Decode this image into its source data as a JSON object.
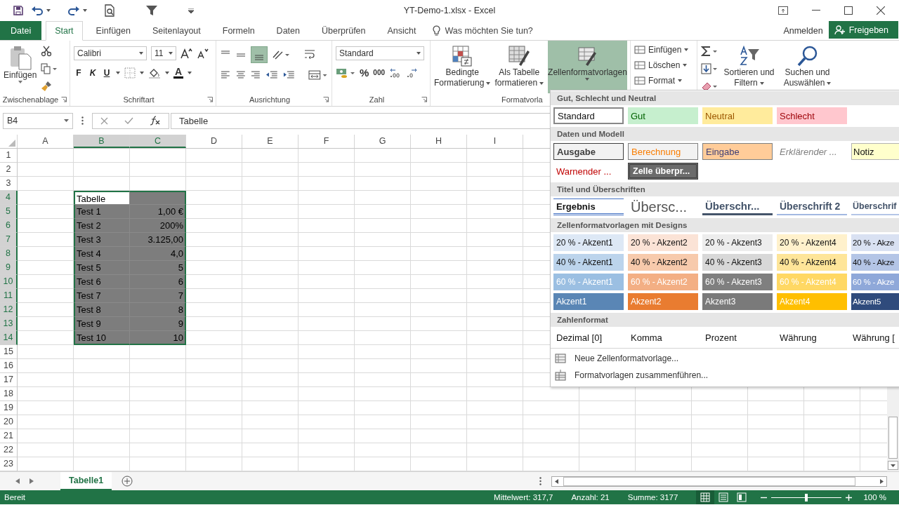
{
  "title_bar": {
    "title": "YT-Demo-1.xlsx - Excel"
  },
  "tabs": [
    {
      "label": "Datei",
      "kind": "file",
      "selected": false
    },
    {
      "label": "Start",
      "kind": "tab",
      "selected": true
    },
    {
      "label": "Einfügen",
      "kind": "tab",
      "selected": false
    },
    {
      "label": "Seitenlayout",
      "kind": "tab",
      "selected": false
    },
    {
      "label": "Formeln",
      "kind": "tab",
      "selected": false
    },
    {
      "label": "Daten",
      "kind": "tab",
      "selected": false
    },
    {
      "label": "Überprüfen",
      "kind": "tab",
      "selected": false
    },
    {
      "label": "Ansicht",
      "kind": "tab",
      "selected": false
    }
  ],
  "tell_me": {
    "placeholder": "Was möchten Sie tun?"
  },
  "account": {
    "sign_in": "Anmelden",
    "share": "Freigeben"
  },
  "ribbon": {
    "clipboard": {
      "paste": "Einfügen",
      "label": "Zwischenablage"
    },
    "font": {
      "name": "Calibri",
      "size": "11",
      "bold": "F",
      "italic": "K",
      "underline": "U",
      "font_color": "A",
      "label": "Schriftart"
    },
    "alignment": {
      "label": "Ausrichtung",
      "bottom_align_on": true
    },
    "number": {
      "format": "Standard",
      "percent": "%",
      "thousands": "000",
      "label": "Zahl"
    },
    "styles": {
      "conditional": [
        "Bedingte",
        "Formatierung"
      ],
      "as_table": [
        "Als Tabelle",
        "formatieren"
      ],
      "cell_styles": {
        "label": "Zellenformatvorlagen",
        "pressed": true
      },
      "label": "Formatvorla"
    },
    "cells": [
      {
        "label": "Einfügen"
      },
      {
        "label": "Löschen"
      },
      {
        "label": "Format"
      }
    ],
    "editing": {
      "sort": [
        "Sortieren und",
        "Filtern"
      ],
      "find": [
        "Suchen und",
        "Auswählen"
      ]
    }
  },
  "formula_bar": {
    "name_box": "B4",
    "content": "Tabelle"
  },
  "sheet": {
    "columns": [
      {
        "label": "A",
        "selected": false
      },
      {
        "label": "B",
        "selected": true
      },
      {
        "label": "C",
        "selected": true
      },
      {
        "label": "D",
        "selected": false
      },
      {
        "label": "E",
        "selected": false
      },
      {
        "label": "F",
        "selected": false
      },
      {
        "label": "G",
        "selected": false
      },
      {
        "label": "H",
        "selected": false
      },
      {
        "label": "I",
        "selected": false
      }
    ],
    "rows": [
      {
        "label": "1",
        "selected": false
      },
      {
        "label": "2",
        "selected": false
      },
      {
        "label": "3",
        "selected": false
      },
      {
        "label": "4",
        "selected": true,
        "cells": [
          {
            "text": "Tabelle",
            "active": true
          }
        ]
      },
      {
        "label": "5",
        "selected": true,
        "cells": [
          {
            "text": "Test 1",
            "active": false
          },
          {
            "text": "1,00 €",
            "active": false
          }
        ]
      },
      {
        "label": "6",
        "selected": true,
        "cells": [
          {
            "text": "Test 2",
            "active": false
          },
          {
            "text": "200%",
            "active": false
          }
        ]
      },
      {
        "label": "7",
        "selected": true,
        "cells": [
          {
            "text": "Test 3",
            "active": false
          },
          {
            "text": "3.125,00",
            "active": false
          }
        ]
      },
      {
        "label": "8",
        "selected": true,
        "cells": [
          {
            "text": "Test 4",
            "active": false
          },
          {
            "text": "4,0",
            "active": false
          }
        ]
      },
      {
        "label": "9",
        "selected": true,
        "cells": [
          {
            "text": "Test 5",
            "active": false
          },
          {
            "text": "5",
            "active": false
          }
        ]
      },
      {
        "label": "10",
        "selected": true,
        "cells": [
          {
            "text": "Test 6",
            "active": false
          },
          {
            "text": "6",
            "active": false
          }
        ]
      },
      {
        "label": "11",
        "selected": true,
        "cells": [
          {
            "text": "Test 7",
            "active": false
          },
          {
            "text": "7",
            "active": false
          }
        ]
      },
      {
        "label": "12",
        "selected": true,
        "cells": [
          {
            "text": "Test 8",
            "active": false
          },
          {
            "text": "8",
            "active": false
          }
        ]
      },
      {
        "label": "13",
        "selected": true,
        "cells": [
          {
            "text": "Test 9",
            "active": false
          },
          {
            "text": "9",
            "active": false
          }
        ]
      },
      {
        "label": "14",
        "selected": true,
        "cells": [
          {
            "text": "Test 10",
            "active": false
          },
          {
            "text": "10",
            "active": false
          }
        ]
      },
      {
        "label": "15",
        "selected": false
      },
      {
        "label": "16",
        "selected": false
      },
      {
        "label": "17",
        "selected": false
      },
      {
        "label": "18",
        "selected": false
      },
      {
        "label": "19",
        "selected": false
      },
      {
        "label": "20",
        "selected": false
      },
      {
        "label": "21",
        "selected": false
      },
      {
        "label": "22",
        "selected": false
      },
      {
        "label": "23",
        "selected": false
      }
    ]
  },
  "sheet_tabs": [
    {
      "label": "Tabelle1",
      "selected": true
    }
  ],
  "status_bar": {
    "ready": "Bereit",
    "average": "Mittelwert: 317,7",
    "count": "Anzahl: 21",
    "sum": "Summe: 3177",
    "zoom": "100 %",
    "zoom_slider": {
      "level": 0.5
    }
  },
  "cell_styles_menu": {
    "sections": [
      {
        "title": "Gut, Schlecht und Neutral",
        "items": [
          {
            "label": "Standard",
            "kind": "standard"
          },
          {
            "label": "Gut",
            "kind": "good",
            "color": "#c6efce"
          },
          {
            "label": "Neutral",
            "kind": "neutral",
            "color": "#ffeb9c"
          },
          {
            "label": "Schlecht",
            "kind": "bad",
            "color": "#ffc7ce"
          }
        ]
      },
      {
        "title": "Daten und Modell",
        "items": [
          {
            "label": "Ausgabe",
            "kind": "output",
            "color": "#f2f2f2"
          },
          {
            "label": "Berechnung",
            "kind": "calc",
            "color": "#f2f2f2"
          },
          {
            "label": "Eingabe",
            "kind": "input",
            "color": "#ffcc99"
          },
          {
            "label": "Erklärender ...",
            "kind": "explain"
          },
          {
            "label": "Notiz",
            "kind": "note",
            "color": "#ffffcc"
          },
          {
            "label": "Warnender ...",
            "kind": "warn"
          },
          {
            "label": "Zelle überpr...",
            "kind": "check",
            "color": "#6b6b6b"
          }
        ]
      },
      {
        "title": "Titel und Überschriften",
        "items": [
          {
            "label": "Ergebnis",
            "kind": "total"
          },
          {
            "label": "Übersc...",
            "kind": "title"
          },
          {
            "label": "Überschr...",
            "kind": "h1"
          },
          {
            "label": "Überschrift 2",
            "kind": "h2"
          },
          {
            "label": "Überschrif",
            "kind": "h3"
          }
        ]
      },
      {
        "title": "Zellenformatvorlagen mit Designs",
        "items": [
          {
            "label": "20 % - Akzent1",
            "kind": "accent-light",
            "color": "#dde8f5"
          },
          {
            "label": "20 % - Akzent2",
            "kind": "accent-light",
            "color": "#fbe3d6"
          },
          {
            "label": "20 % - Akzent3",
            "kind": "accent-light",
            "color": "#ededed"
          },
          {
            "label": "20 % - Akzent4",
            "kind": "accent-light",
            "color": "#fff1cc"
          },
          {
            "label": "20 % - Akze",
            "kind": "accent-light",
            "color": "#d9e1f2"
          },
          {
            "label": "40 % - Akzent1",
            "kind": "accent-light",
            "color": "#bcd4ec"
          },
          {
            "label": "40 % - Akzent2",
            "kind": "accent-light",
            "color": "#f7caac"
          },
          {
            "label": "40 % - Akzent3",
            "kind": "accent-light",
            "color": "#d8d8d8"
          },
          {
            "label": "40 % - Akzent4",
            "kind": "accent-light",
            "color": "#fee599"
          },
          {
            "label": "40 % - Akze",
            "kind": "accent-light",
            "color": "#b4c5e6"
          },
          {
            "label": "60 % - Akzent1",
            "kind": "accent-dark",
            "color": "#9bbfe2"
          },
          {
            "label": "60 % - Akzent2",
            "kind": "accent-dark",
            "color": "#f3af84"
          },
          {
            "label": "60 % - Akzent3",
            "kind": "accent-dark",
            "color": "#7f7f7f"
          },
          {
            "label": "60 % - Akzent4",
            "kind": "accent-dark",
            "color": "#ffd864"
          },
          {
            "label": "60 % - Akze",
            "kind": "accent-dark",
            "color": "#8fa8d9"
          },
          {
            "label": "Akzent1",
            "kind": "accent-dark",
            "color": "#5a86b5"
          },
          {
            "label": "Akzent2",
            "kind": "accent-dark",
            "color": "#e97c30"
          },
          {
            "label": "Akzent3",
            "kind": "accent-dark",
            "color": "#7a7a7a"
          },
          {
            "label": "Akzent4",
            "kind": "accent-dark",
            "color": "#ffbf00"
          },
          {
            "label": "Akzent5",
            "kind": "accent-dark",
            "color": "#2f4b7c"
          }
        ]
      },
      {
        "title": "Zahlenformat",
        "items": [
          {
            "label": "Dezimal [0]",
            "kind": "plain"
          },
          {
            "label": "Komma",
            "kind": "plain"
          },
          {
            "label": "Prozent",
            "kind": "plain"
          },
          {
            "label": "Währung",
            "kind": "plain"
          },
          {
            "label": "Währung [",
            "kind": "plain"
          }
        ]
      }
    ],
    "commands": [
      {
        "label": "Neue Zellenformatvorlage...",
        "kind": "new"
      },
      {
        "label": "Formatvorlagen zusammenführen...",
        "kind": "merge"
      }
    ]
  }
}
